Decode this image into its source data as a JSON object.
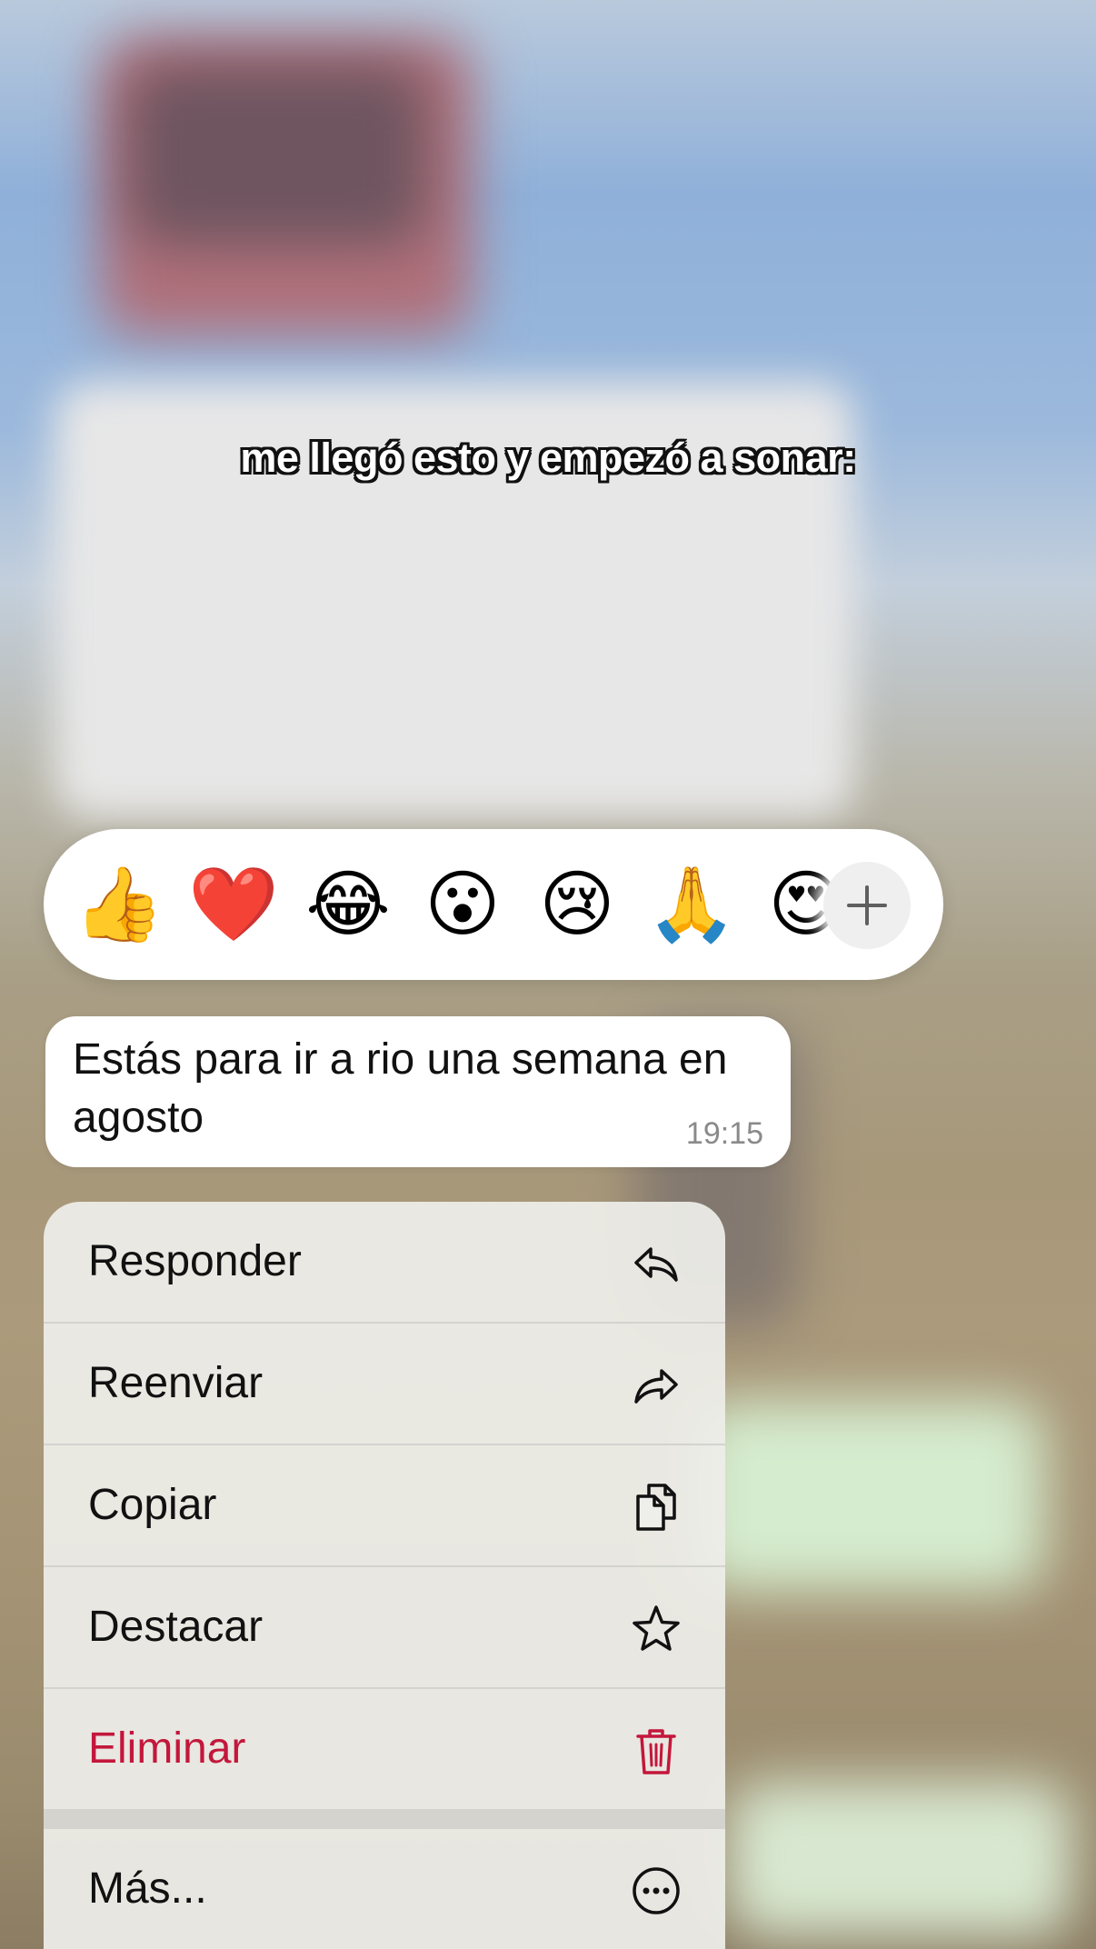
{
  "background_caption": "me llegó esto y empezó a sonar:",
  "reactions": {
    "emojis": [
      {
        "glyph": "👍",
        "name": "thumbs-up"
      },
      {
        "glyph": "❤️",
        "name": "red-heart"
      },
      {
        "glyph": "😂",
        "name": "tears-of-joy"
      },
      {
        "glyph": "😮",
        "name": "open-mouth"
      },
      {
        "glyph": "😢",
        "name": "crying-face"
      },
      {
        "glyph": "🙏",
        "name": "folded-hands"
      },
      {
        "glyph": "😍",
        "name": "heart-eyes"
      }
    ],
    "more_icon": "plus-icon"
  },
  "message": {
    "text": "Estás para ir a rio una semana en agosto",
    "time": "19:15"
  },
  "menu": {
    "items": [
      {
        "label": "Responder",
        "icon": "reply-icon"
      },
      {
        "label": "Reenviar",
        "icon": "forward-icon"
      },
      {
        "label": "Copiar",
        "icon": "copy-icon"
      },
      {
        "label": "Destacar",
        "icon": "star-icon"
      },
      {
        "label": "Eliminar",
        "icon": "trash-icon",
        "color": "#c3173b"
      },
      {
        "label": "Más...",
        "icon": "more-icon"
      }
    ]
  }
}
